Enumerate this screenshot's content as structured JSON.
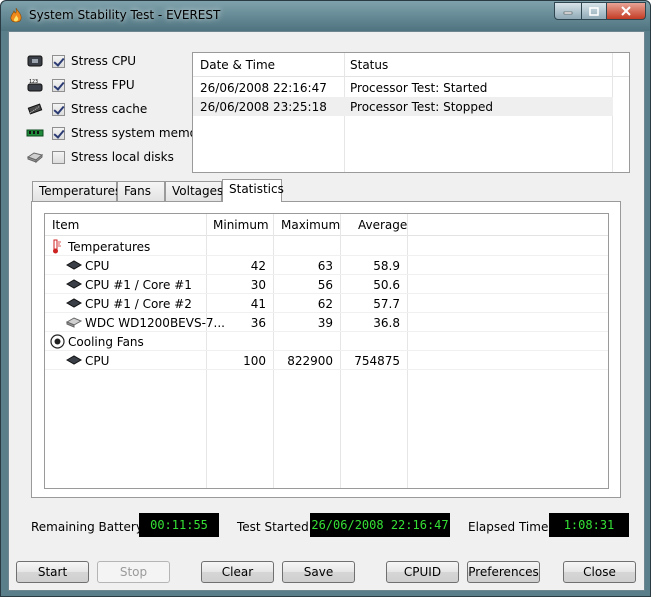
{
  "window": {
    "title": "System Stability Test - EVEREST"
  },
  "stress_options": [
    {
      "label": "Stress CPU",
      "checked": true,
      "icon": "cpu-chip-icon"
    },
    {
      "label": "Stress FPU",
      "checked": true,
      "icon": "fpu-icon"
    },
    {
      "label": "Stress cache",
      "checked": true,
      "icon": "cache-chip-icon"
    },
    {
      "label": "Stress system memory",
      "checked": true,
      "icon": "memory-module-icon"
    },
    {
      "label": "Stress local disks",
      "checked": false,
      "icon": "hard-disk-icon"
    }
  ],
  "log": {
    "columns": [
      "Date & Time",
      "Status"
    ],
    "rows": [
      [
        "26/06/2008 22:16:47",
        "Processor Test: Started"
      ],
      [
        "26/06/2008 23:25:18",
        "Processor Test: Stopped"
      ]
    ]
  },
  "tabs": [
    "Temperatures",
    "Fans",
    "Voltages",
    "Statistics"
  ],
  "active_tab": "Statistics",
  "stats": {
    "columns": [
      "Item",
      "Minimum",
      "Maximum",
      "Average"
    ],
    "groups": [
      {
        "name": "Temperatures",
        "rows": [
          {
            "item": "CPU",
            "min": "42",
            "max": "63",
            "avg": "58.9"
          },
          {
            "item": "CPU #1 / Core #1",
            "min": "30",
            "max": "56",
            "avg": "50.6"
          },
          {
            "item": "CPU #1 / Core #2",
            "min": "41",
            "max": "62",
            "avg": "57.7"
          },
          {
            "item": "WDC WD1200BEVS-7...",
            "min": "36",
            "max": "39",
            "avg": "36.8"
          }
        ]
      },
      {
        "name": "Cooling Fans",
        "rows": [
          {
            "item": "CPU",
            "min": "100",
            "max": "822900",
            "avg": "754875"
          }
        ]
      }
    ]
  },
  "status": {
    "battery_label": "Remaining Battery:",
    "battery_value": "00:11:55",
    "started_label": "Test Started:",
    "started_value": "26/06/2008 22:16:47",
    "elapsed_label": "Elapsed Time:",
    "elapsed_value": "1:08:31"
  },
  "buttons": {
    "start": "Start",
    "stop": "Stop",
    "clear": "Clear",
    "save": "Save",
    "cpuid": "CPUID",
    "preferences": "Preferences",
    "close": "Close"
  },
  "colors": {
    "lcd_text": "#35e035",
    "lcd_bg": "#000000",
    "frame": "#5a7f8a"
  }
}
